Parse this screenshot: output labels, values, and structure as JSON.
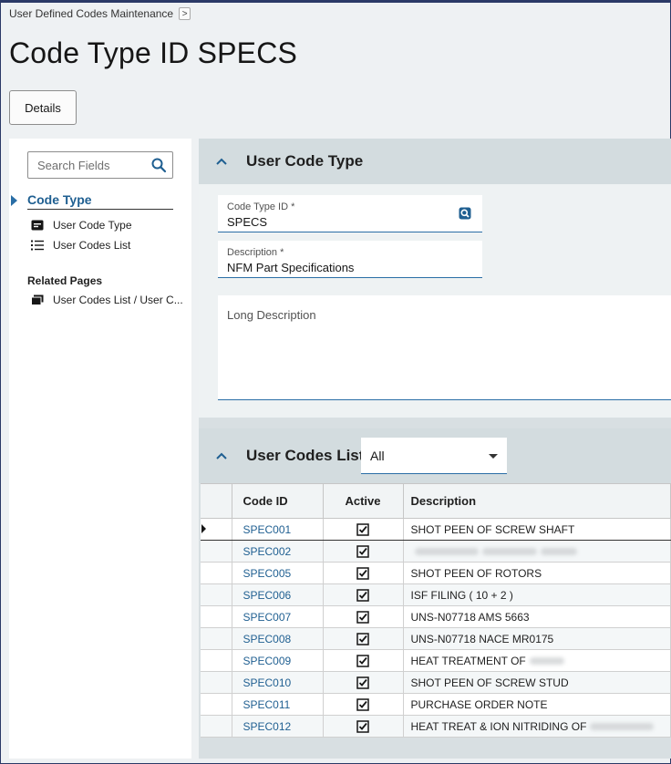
{
  "breadcrumb": {
    "label": "User Defined Codes Maintenance",
    "chevron": ">"
  },
  "page": {
    "title": "Code Type ID SPECS"
  },
  "toolbar": {
    "details_label": "Details"
  },
  "left_panel": {
    "search_placeholder": "Search Fields",
    "nav_head": "Code Type",
    "items": [
      {
        "label": "User Code Type",
        "icon": "form-icon"
      },
      {
        "label": "User Codes List",
        "icon": "list-icon"
      }
    ],
    "related_title": "Related Pages",
    "related_items": [
      {
        "label": "User Codes List / User C...",
        "icon": "pages-icon"
      }
    ]
  },
  "user_code_type": {
    "title": "User Code Type",
    "code_type_id_label": "Code Type ID *",
    "code_type_id_value": "SPECS",
    "description_label": "Description *",
    "description_value": "NFM Part Specifications",
    "long_description_label": "Long Description"
  },
  "user_codes_list": {
    "title": "User Codes List",
    "filter_value": "All",
    "columns": [
      "Code ID",
      "Active",
      "Description"
    ],
    "rows": [
      {
        "code": "SPEC001",
        "active": true,
        "description": "SHOT PEEN OF SCREW SHAFT"
      },
      {
        "code": "SPEC002",
        "active": true,
        "description": ""
      },
      {
        "code": "SPEC005",
        "active": true,
        "description": "SHOT PEEN OF ROTORS"
      },
      {
        "code": "SPEC006",
        "active": true,
        "description": "ISF FILING ( 10 + 2 )"
      },
      {
        "code": "SPEC007",
        "active": true,
        "description": "UNS-N07718 AMS 5663"
      },
      {
        "code": "SPEC008",
        "active": true,
        "description": "UNS-N07718 NACE MR0175"
      },
      {
        "code": "SPEC009",
        "active": true,
        "description": "HEAT TREATMENT OF"
      },
      {
        "code": "SPEC010",
        "active": true,
        "description": "SHOT PEEN OF SCREW STUD"
      },
      {
        "code": "SPEC011",
        "active": true,
        "description": "PURCHASE ORDER NOTE"
      },
      {
        "code": "SPEC012",
        "active": true,
        "description": "HEAT TREAT & ION NITRIDING OF"
      }
    ]
  },
  "colors": {
    "accent": "#1f5f91",
    "frame": "#2b3a67",
    "panel": "#d3dcdf"
  }
}
